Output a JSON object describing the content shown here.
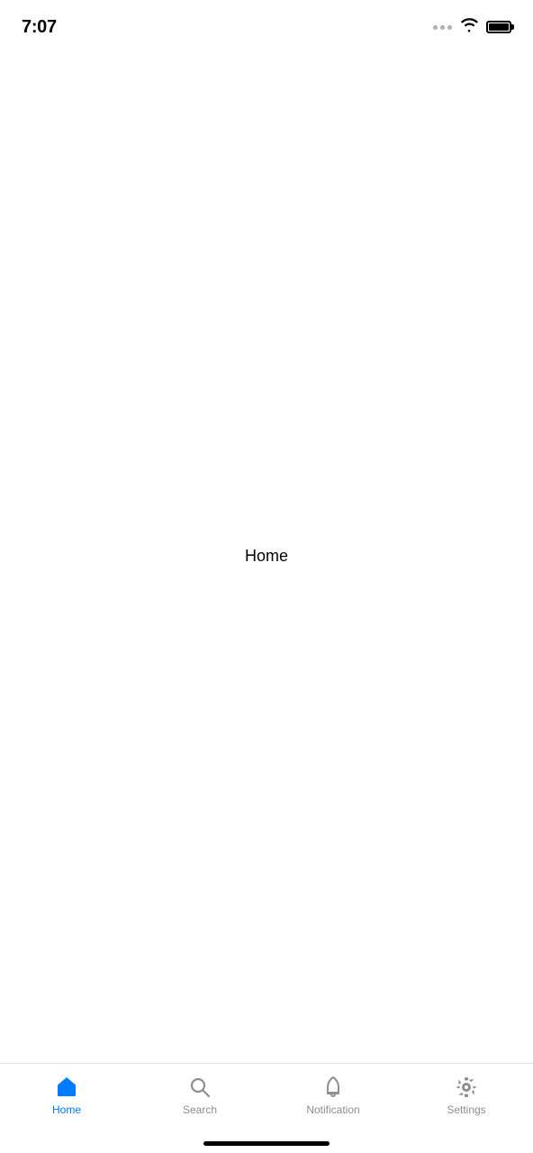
{
  "status_bar": {
    "time": "7:07"
  },
  "main": {
    "page_label": "Home"
  },
  "tab_bar": {
    "items": [
      {
        "id": "home",
        "label": "Home",
        "active": true,
        "color": "#007AFF",
        "inactive_color": "#8e8e93"
      },
      {
        "id": "search",
        "label": "Search",
        "active": false,
        "color": "#8e8e93",
        "inactive_color": "#8e8e93"
      },
      {
        "id": "notification",
        "label": "Notification",
        "active": false,
        "color": "#8e8e93",
        "inactive_color": "#8e8e93"
      },
      {
        "id": "settings",
        "label": "Settings",
        "active": false,
        "color": "#8e8e93",
        "inactive_color": "#8e8e93"
      }
    ]
  }
}
